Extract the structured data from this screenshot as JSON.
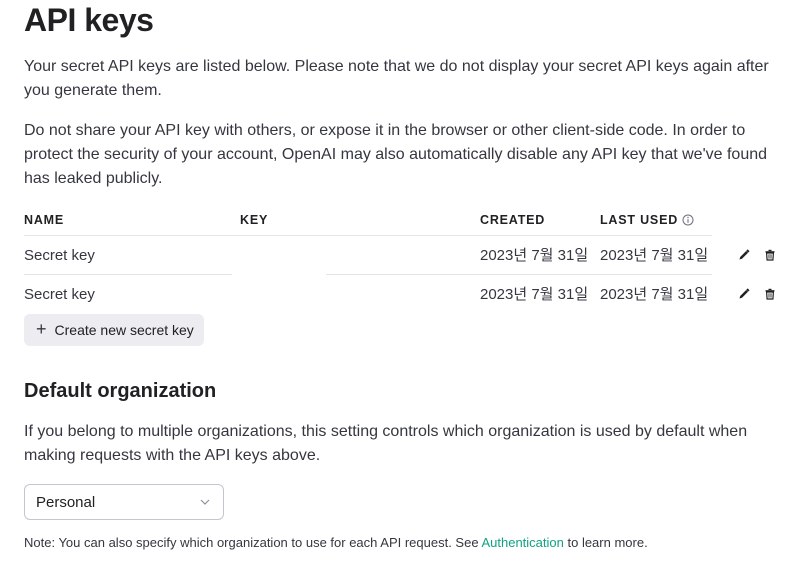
{
  "page": {
    "title": "API keys",
    "intro": "Your secret API keys are listed below. Please note that we do not display your secret API keys again after you generate them.",
    "warning": "Do not share your API key with others, or expose it in the browser or other client-side code. In order to protect the security of your account, OpenAI may also automatically disable any API key that we've found has leaked publicly."
  },
  "table": {
    "headers": {
      "name": "NAME",
      "key": "KEY",
      "created": "CREATED",
      "last_used": "LAST USED"
    },
    "rows": [
      {
        "name": "Secret key",
        "key": "",
        "created": "2023년 7월 31일",
        "last_used": "2023년 7월 31일"
      },
      {
        "name": "Secret key",
        "key": "",
        "created": "2023년 7월 31일",
        "last_used": "2023년 7월 31일"
      }
    ],
    "icons": {
      "edit": "pencil-icon",
      "delete": "trash-icon",
      "info": "info-icon"
    }
  },
  "create_button": {
    "icon": "plus-icon",
    "label": "Create new secret key"
  },
  "default_org": {
    "title": "Default organization",
    "description": "If you belong to multiple organizations, this setting controls which organization is used by default when making requests with the API keys above.",
    "selected": "Personal"
  },
  "note": {
    "before": "Note: You can also specify which organization to use for each API request. See ",
    "link": "Authentication",
    "after": " to learn more."
  },
  "colors": {
    "accent": "#10a37f",
    "button_bg": "#ececf1",
    "text": "#202123"
  }
}
